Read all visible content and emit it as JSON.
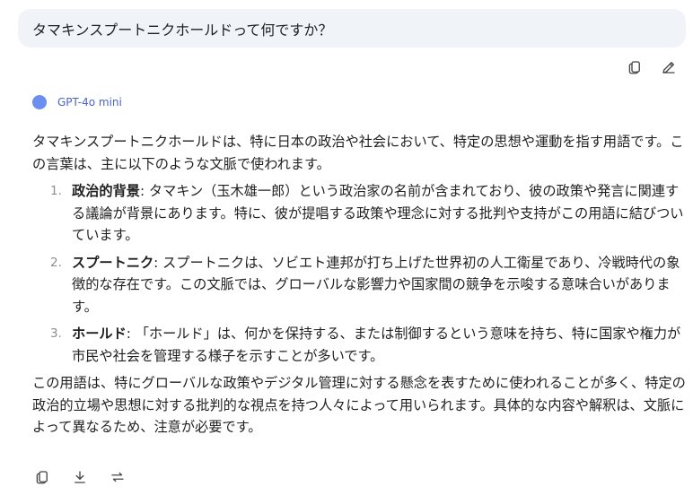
{
  "user_message": "タマキンスプートニクホールドって何ですか？",
  "model": {
    "name": "GPT-4o mini",
    "accent": "#6b8ef0"
  },
  "answer": {
    "intro": "タマキンスプートニクホールドは、特に日本の政治や社会において、特定の思想や運動を指す用語です。この言葉は、主に以下のような文脈で使われます。",
    "items": [
      {
        "number": "1.",
        "term": "政治的背景",
        "text": ": タマキン（玉木雄一郎）という政治家の名前が含まれており、彼の政策や発言に関連する議論が背景にあります。特に、彼が提唱する政策や理念に対する批判や支持がこの用語に結びついています。"
      },
      {
        "number": "2.",
        "term": "スプートニク",
        "text": ": スプートニクは、ソビエト連邦が打ち上げた世界初の人工衛星であり、冷戦時代の象徴的な存在です。この文脈では、グローバルな影響力や国家間の競争を示唆する意味合いがあります。"
      },
      {
        "number": "3.",
        "term": "ホールド",
        "text": ": 「ホールド」は、何かを保持する、または制御するという意味を持ち、特に国家や権力が市民や社会を管理する様子を示すことが多いです。"
      }
    ],
    "conclusion": "この用語は、特にグローバルな政策やデジタル管理に対する懸念を表すために使われることが多く、特定の政治的立場や思想に対する批判的な視点を持つ人々によって用いられます。具体的な内容や解釈は、文脈によって異なるため、注意が必要です。"
  },
  "icons": {
    "user_actions": [
      "copy-icon",
      "edit-icon"
    ],
    "response_actions": [
      "copy-icon",
      "download-icon",
      "regenerate-icon"
    ]
  }
}
